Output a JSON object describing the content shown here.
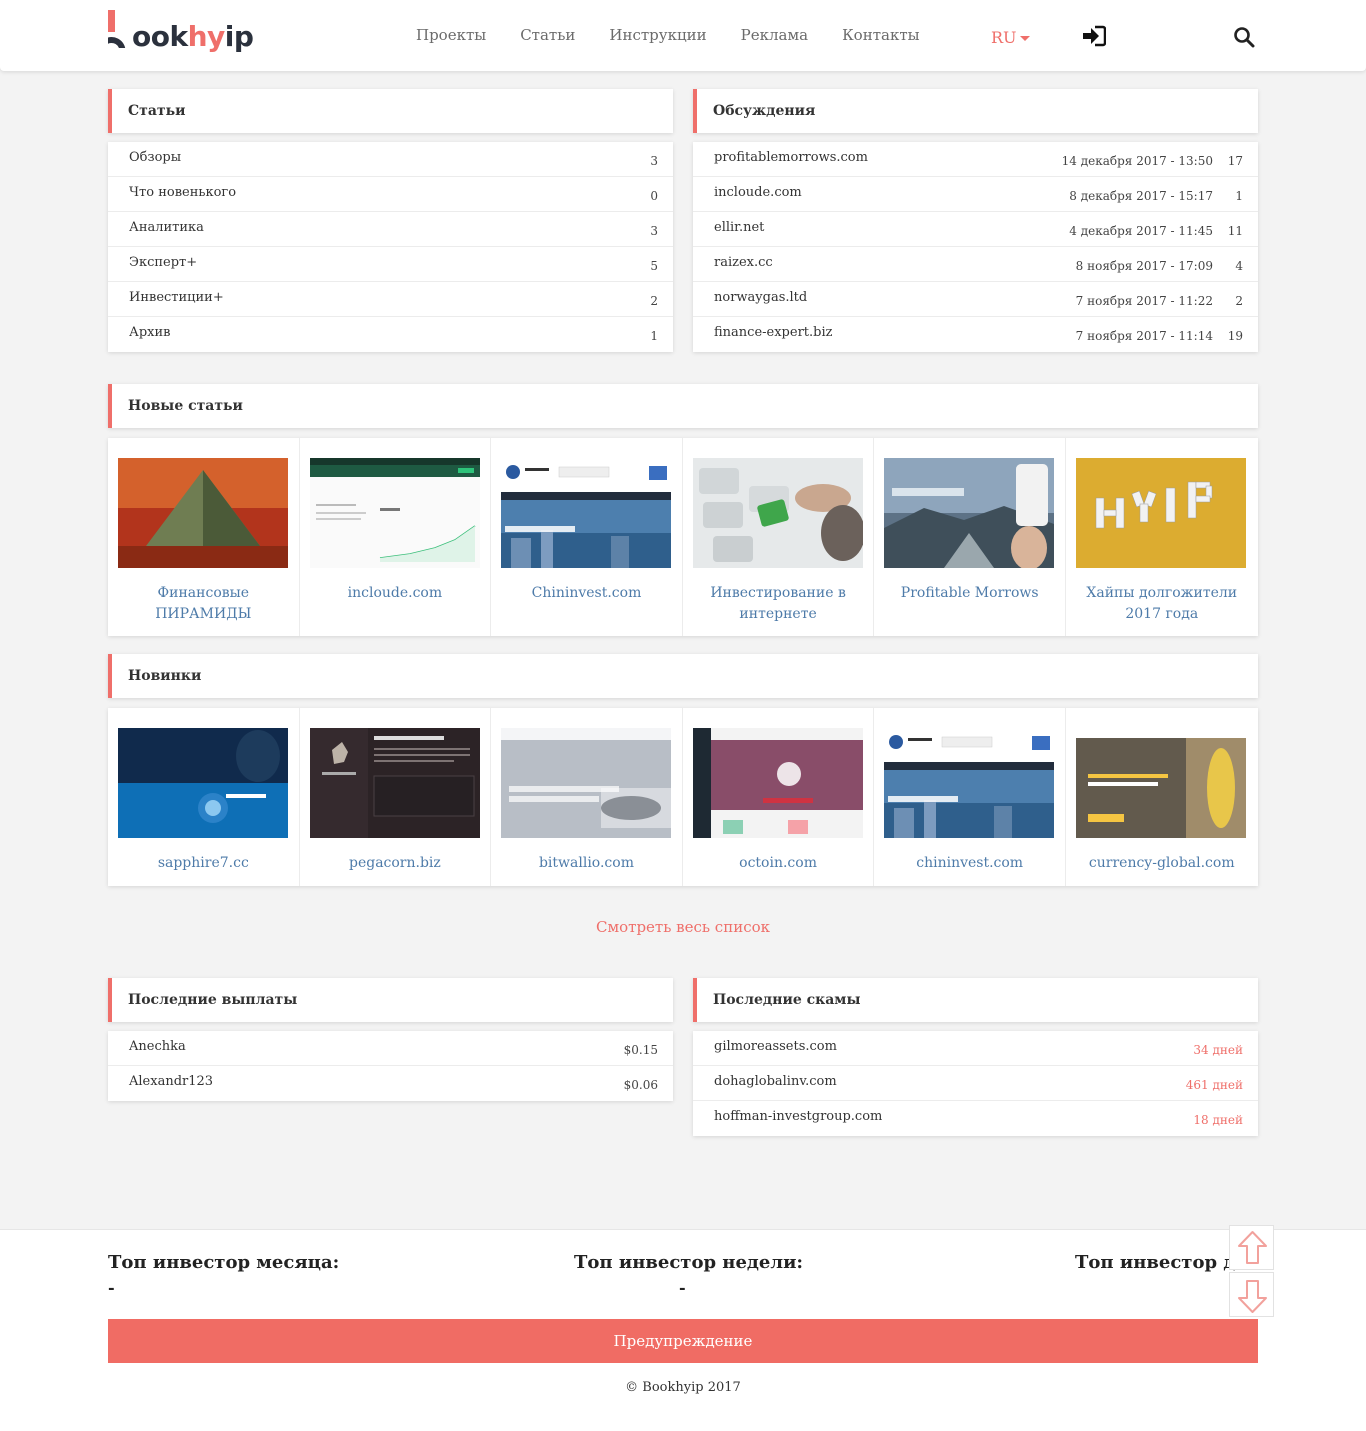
{
  "header": {
    "logo_text_a": "ook",
    "logo_text_b": "hy",
    "logo_text_c": "ip",
    "nav": [
      "Проекты",
      "Статьи",
      "Инструкции",
      "Реклама",
      "Контакты"
    ],
    "lang": "RU"
  },
  "articles": {
    "title": "Статьи",
    "items": [
      {
        "name": "Обзоры",
        "count": "3"
      },
      {
        "name": "Что новенького",
        "count": "0"
      },
      {
        "name": "Аналитика",
        "count": "3"
      },
      {
        "name": "Эксперт+",
        "count": "5"
      },
      {
        "name": "Инвестиции+",
        "count": "2"
      },
      {
        "name": "Архив",
        "count": "1"
      }
    ]
  },
  "discussions": {
    "title": "Обсуждения",
    "items": [
      {
        "name": "profitablemorrows.com",
        "date": "14 декабря 2017 - 13:50",
        "count": "17"
      },
      {
        "name": "incloude.com",
        "date": "8 декабря 2017 - 15:17",
        "count": "1"
      },
      {
        "name": "ellir.net",
        "date": "4 декабря 2017 - 11:45",
        "count": "11"
      },
      {
        "name": "raizex.cc",
        "date": "8 ноября 2017 - 17:09",
        "count": "4"
      },
      {
        "name": "norwaygas.ltd",
        "date": "7 ноября 2017 - 11:22",
        "count": "2"
      },
      {
        "name": "finance-expert.biz",
        "date": "7 ноября 2017 - 11:14",
        "count": "19"
      }
    ]
  },
  "new_articles": {
    "title": "Новые статьи",
    "items": [
      {
        "title": "Финансовые ПИРАМИДЫ"
      },
      {
        "title": "incloude.com"
      },
      {
        "title": "Chininvest.com"
      },
      {
        "title": "Инвестирование в интернете"
      },
      {
        "title": "Profitable Morrows"
      },
      {
        "title": "Хайпы долгожители 2017 года"
      }
    ]
  },
  "new_projects": {
    "title": "Новинки",
    "items": [
      {
        "title": "sapphire7.cc"
      },
      {
        "title": "pegacorn.biz"
      },
      {
        "title": "bitwallio.com"
      },
      {
        "title": "octoin.com"
      },
      {
        "title": "chininvest.com"
      },
      {
        "title": "currency-global.com"
      }
    ]
  },
  "see_all": "Смотреть весь список",
  "payouts": {
    "title": "Последние выплаты",
    "items": [
      {
        "name": "Anechka",
        "amount": "$0.15"
      },
      {
        "name": "Alexandr123",
        "amount": "$0.06"
      }
    ]
  },
  "scams": {
    "title": "Последние скамы",
    "items": [
      {
        "name": "gilmoreassets.com",
        "days": "34 дней"
      },
      {
        "name": "dohaglobalinv.com",
        "days": "461 дней"
      },
      {
        "name": "hoffman-investgroup.com",
        "days": "18 дней"
      }
    ]
  },
  "footer": {
    "top_month": "Топ инвестор месяца:",
    "top_week": "Топ инвестор недели:",
    "top_day": "Топ инвестор дня:",
    "dash": "-",
    "warning": "Предупреждение",
    "copyright": "© Bookhyip 2017"
  },
  "colors": {
    "accent": "#ef6f6a",
    "link": "#4e7ba9",
    "dark": "#2b313d"
  }
}
